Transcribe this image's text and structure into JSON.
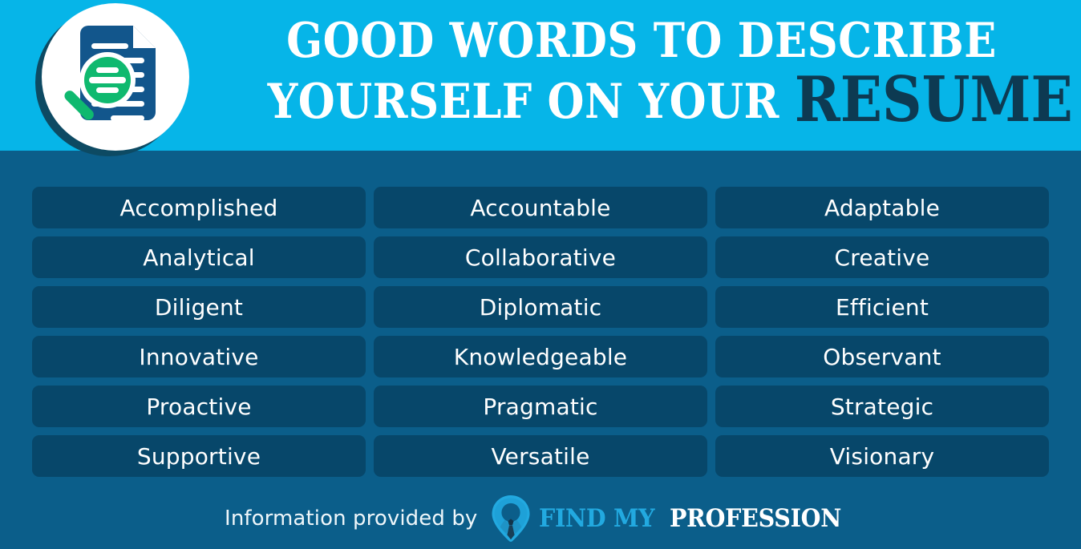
{
  "header": {
    "title_line_1": "GOOD WORDS TO DESCRIBE",
    "title_line_2": "YOURSELF ON YOUR",
    "title_accent": "RESUME",
    "background_color": "#06b5e8",
    "title_color": "#ffffff",
    "accent_color": "#0d3a52"
  },
  "badge": {
    "icon_name": "document-search-icon",
    "circle_color": "#ffffff",
    "shadow_color": "#0d4a63",
    "document_color": "#12568c",
    "magnifier_color": "#0fb96f"
  },
  "body": {
    "background_color": "#0b5e8a",
    "pill_color": "#07476a",
    "pill_text_color": "#ffffff"
  },
  "words": {
    "columns": [
      {
        "name": "column-1",
        "items": [
          "Accomplished",
          "Analytical",
          "Diligent",
          "Innovative",
          "Proactive",
          "Supportive"
        ]
      },
      {
        "name": "column-2",
        "items": [
          "Accountable",
          "Collaborative",
          "Diplomatic",
          "Knowledgeable",
          "Pragmatic",
          "Versatile"
        ]
      },
      {
        "name": "column-3",
        "items": [
          "Adaptable",
          "Creative",
          "Efficient",
          "Observant",
          "Strategic",
          "Visionary"
        ]
      }
    ],
    "rows": [
      [
        "Accomplished",
        "Accountable",
        "Adaptable"
      ],
      [
        "Analytical",
        "Collaborative",
        "Creative"
      ],
      [
        "Diligent",
        "Diplomatic",
        "Efficient"
      ],
      [
        "Innovative",
        "Knowledgeable",
        "Observant"
      ],
      [
        "Proactive",
        "Pragmatic",
        "Strategic"
      ],
      [
        "Supportive",
        "Versatile",
        "Visionary"
      ]
    ]
  },
  "footer": {
    "credit_text": "Information provided by",
    "logo_mark_name": "profession-pin-tie-icon",
    "wordmark_primary": "FIND MY",
    "wordmark_secondary": "PROFESSION",
    "wordmark_primary_color": "#22a9e0",
    "wordmark_secondary_color": "#ffffff"
  }
}
